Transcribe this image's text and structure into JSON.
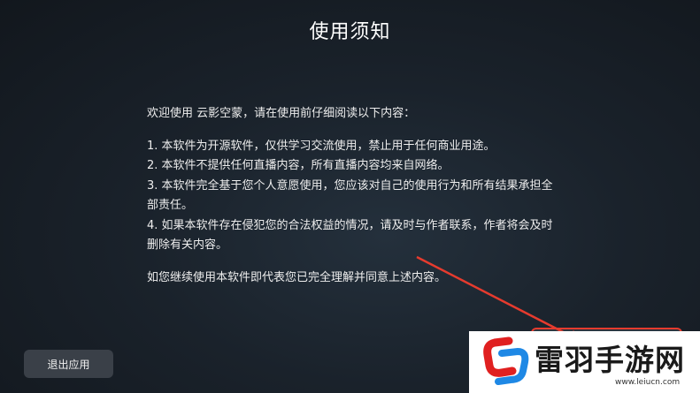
{
  "dialog": {
    "title": "使用须知",
    "intro": "欢迎使用 云影空蒙，请在使用前仔细阅读以下内容：",
    "items": [
      "1. 本软件为开源软件，仅供学习交流使用，禁止用于任何商业用途。",
      "2. 本软件不提供任何直播内容，所有直播内容均来自网络。",
      "3. 本软件完全基于您个人意愿使用，您应该对自己的使用行为和所有结果承担全部责任。",
      "4. 如果本软件存在侵犯您的合法权益的情况，请及时与作者联系，作者将会及时删除有关内容。"
    ],
    "closing": "如您继续使用本软件即代表您已完全理解并同意上述内容。"
  },
  "buttons": {
    "exit_label": "退出应用",
    "agree_label": ""
  },
  "watermark": {
    "title": "雷羽手游网",
    "url": "www.leiucn.com"
  },
  "colors": {
    "highlight": "#e63b2e",
    "background": "#1a222b"
  }
}
